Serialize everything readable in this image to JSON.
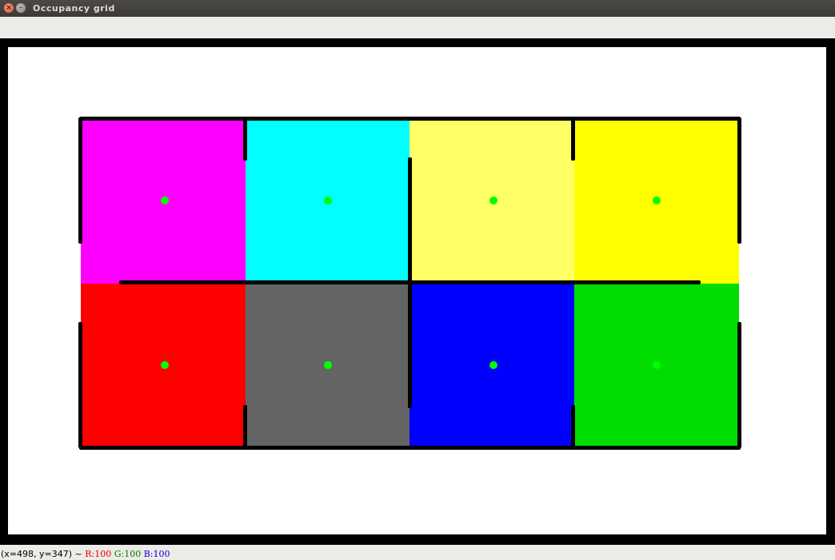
{
  "window": {
    "title": "Occupancy grid",
    "close_glyph": "×",
    "minimize_glyph": "–"
  },
  "grid": {
    "rows": 2,
    "cols": 4,
    "cells": [
      {
        "color": "#ff00ff",
        "has_dot": true
      },
      {
        "color": "#00ffff",
        "has_dot": true
      },
      {
        "color": "#ffff66",
        "has_dot": true
      },
      {
        "color": "#ffff00",
        "has_dot": true
      },
      {
        "color": "#ff0000",
        "has_dot": true
      },
      {
        "color": "#646464",
        "has_dot": true
      },
      {
        "color": "#0000ff",
        "has_dot": true
      },
      {
        "color": "#00dd00",
        "has_dot": true
      }
    ],
    "dot_color": "#00ff00",
    "wall_color": "#000000"
  },
  "status": {
    "coords": "(x=498, y=347) ~",
    "r": "R:100",
    "g": "G:100",
    "b": "B:100"
  }
}
